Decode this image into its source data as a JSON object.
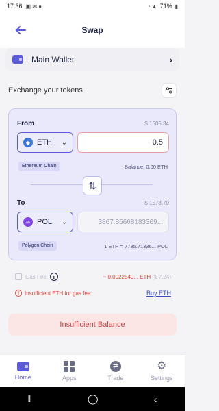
{
  "status_bar": {
    "time": "17:36",
    "battery": "71%"
  },
  "header": {
    "title": "Swap"
  },
  "wallet": {
    "label": "Main Wallet"
  },
  "exchange": {
    "title": "Exchange your tokens"
  },
  "from": {
    "label": "From",
    "usd_value": "$ 1605.34",
    "token": "ETH",
    "amount": "0.5",
    "chain": "Ethereum Chain",
    "balance": "Balance: 0.00 ETH"
  },
  "to": {
    "label": "To",
    "usd_value": "$ 1578.70",
    "token": "POL",
    "amount": "3867.85668183369...",
    "chain": "Polygon Chain",
    "rate": "1 ETH = 7735.71336... POL"
  },
  "gas": {
    "label": "Gas Fee",
    "value": "~ 0.0022540... ETH",
    "usd": "($ 7.24)"
  },
  "error": {
    "message": "Insufficient ETH for gas fee",
    "buy_label": "Buy ETH"
  },
  "action": {
    "label": "Insufficient Balance"
  },
  "tabs": [
    {
      "label": "Home",
      "icon": "wallet-icon",
      "active": true
    },
    {
      "label": "Apps",
      "icon": "grid-icon",
      "active": false
    },
    {
      "label": "Trade",
      "icon": "trade-icon",
      "active": false
    },
    {
      "label": "Settings",
      "icon": "gear-icon",
      "active": false
    }
  ],
  "colors": {
    "accent": "#5b5bd6",
    "error": "#e0403a",
    "card_bg": "#e9e9fb"
  }
}
